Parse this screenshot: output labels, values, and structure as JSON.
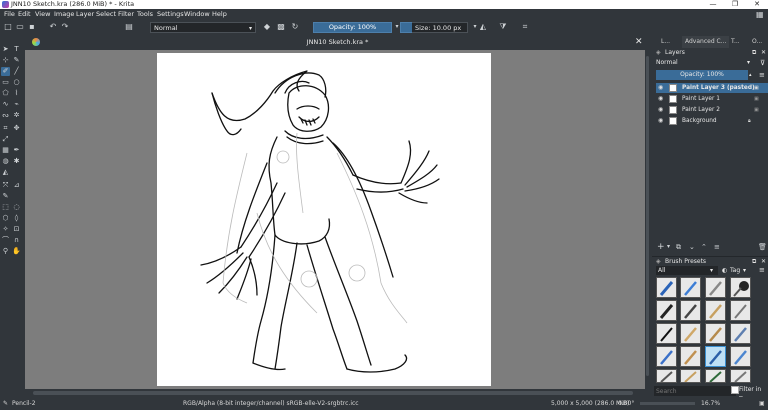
{
  "window": {
    "title": "JNN10 Sketch.kra (286.0 MiB)  * - Krita",
    "minimize": "—",
    "maximize": "❐",
    "close": "✕"
  },
  "menu": [
    "File",
    "Edit",
    "View",
    "Image",
    "Layer",
    "Select",
    "Filter",
    "Tools",
    "Settings",
    "Window",
    "Help"
  ],
  "toolbar": {
    "blend_mode": "Normal",
    "opacity": "Opacity: 100%",
    "size": "Size: 10.00 px"
  },
  "document_tab": {
    "title": "JNN10 Sketch.kra *",
    "close": "✕"
  },
  "dock_tabs": [
    "L...",
    "Advanced C...",
    "T...",
    "O..."
  ],
  "layers": {
    "header": "Layers",
    "blend_mode": "Normal",
    "opacity": "Opacity:  100%",
    "items": [
      {
        "name": "Paint Layer 3 (pasted)",
        "active": true
      },
      {
        "name": "Paint Layer 1",
        "active": false
      },
      {
        "name": "Paint Layer 2",
        "active": false
      },
      {
        "name": "Background",
        "active": false
      }
    ]
  },
  "brush_presets": {
    "header": "Brush Presets",
    "filter": "All",
    "tag": "Tag",
    "search_placeholder": "Search",
    "filter_in_tag": "Filter in Tag"
  },
  "status": {
    "brush": "Pencil-2",
    "color_info": "RGB/Alpha (8-bit integer/channel)  sRGB-elle-V2-srgbtrc.icc",
    "dimensions": "5,000 x 5,000 (286.0 MiB)",
    "rotation": "0.00°",
    "zoom": "16.7%"
  }
}
